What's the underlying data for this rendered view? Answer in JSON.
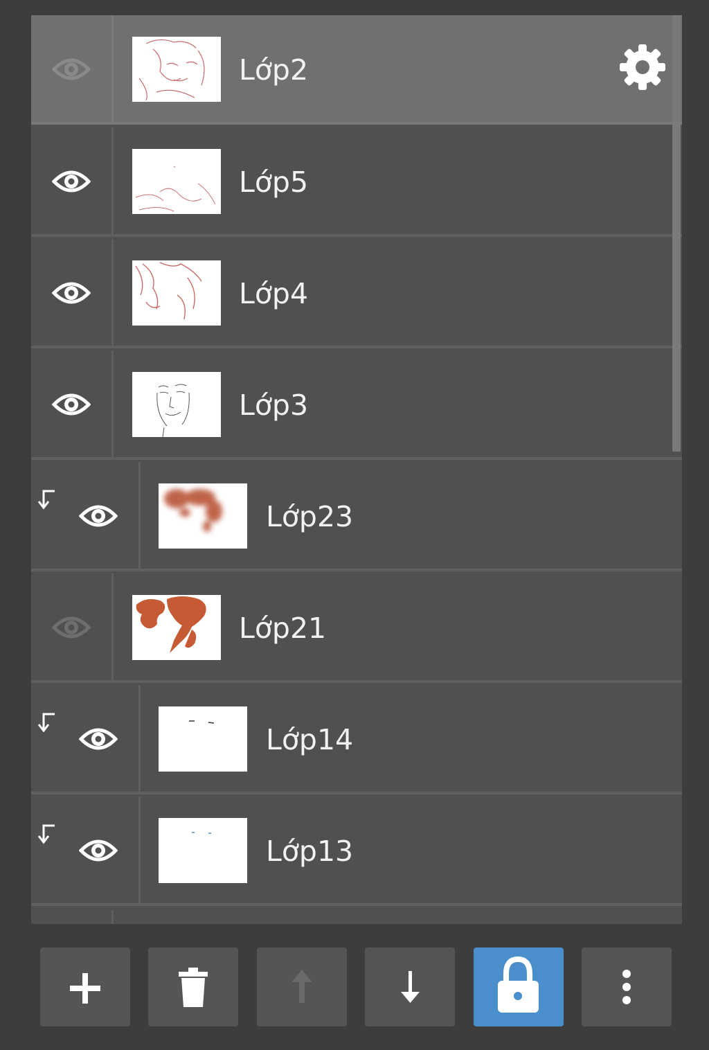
{
  "layers": [
    {
      "name": "Lớp2",
      "visible": false,
      "selected": true,
      "clipped": false
    },
    {
      "name": "Lớp5",
      "visible": true,
      "selected": false,
      "clipped": false
    },
    {
      "name": "Lớp4",
      "visible": true,
      "selected": false,
      "clipped": false
    },
    {
      "name": "Lớp3",
      "visible": true,
      "selected": false,
      "clipped": false
    },
    {
      "name": "Lớp23",
      "visible": true,
      "selected": false,
      "clipped": true
    },
    {
      "name": "Lớp21",
      "visible": false,
      "selected": false,
      "clipped": false
    },
    {
      "name": "Lớp14",
      "visible": true,
      "selected": false,
      "clipped": true
    },
    {
      "name": "Lớp13",
      "visible": true,
      "selected": false,
      "clipped": true
    }
  ],
  "toolbar": {
    "buttons": [
      {
        "icon": "plus-icon",
        "enabled": true,
        "active": false
      },
      {
        "icon": "trash-icon",
        "enabled": true,
        "active": false
      },
      {
        "icon": "arrow-up-icon",
        "enabled": false,
        "active": false
      },
      {
        "icon": "arrow-down-icon",
        "enabled": true,
        "active": false
      },
      {
        "icon": "lock-icon",
        "enabled": true,
        "active": true
      },
      {
        "icon": "more-vertical-icon",
        "enabled": true,
        "active": false
      }
    ]
  },
  "colors": {
    "background": "#3d3d3d",
    "panel": "#505050",
    "selected_row": "#707070",
    "accent": "#4a8fcc",
    "sketch_red": "#c0504d",
    "fill_orange": "#c55a35"
  }
}
